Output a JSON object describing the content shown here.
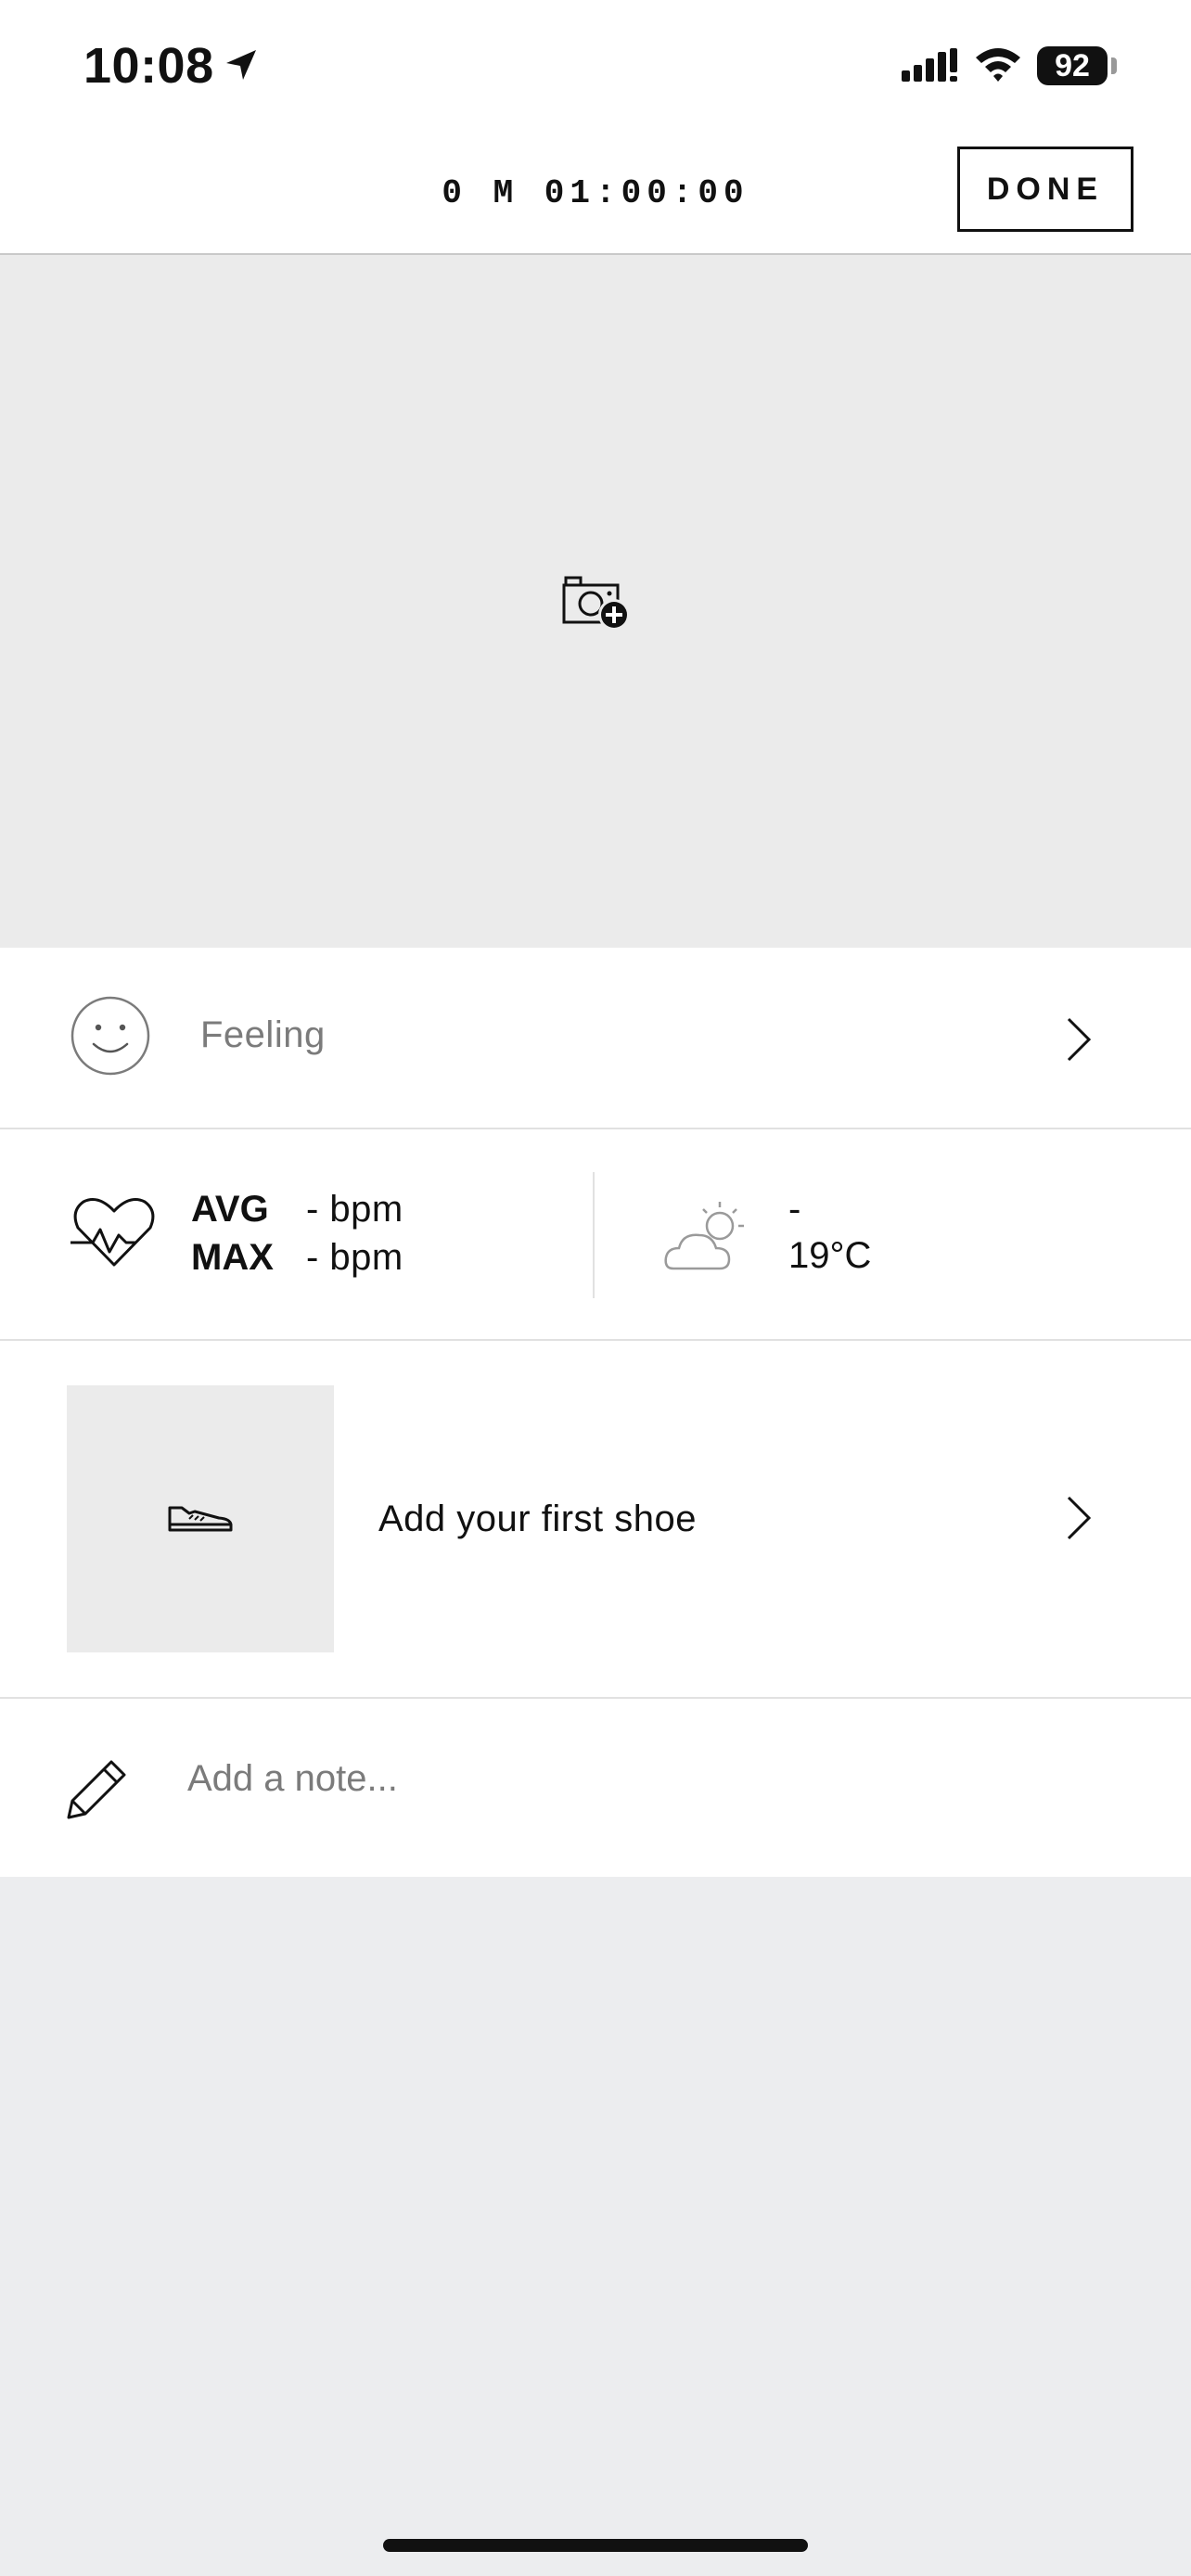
{
  "status_bar": {
    "time": "10:08",
    "battery": "92",
    "icons": [
      "location-arrow-icon",
      "cellular-signal-icon",
      "wifi-icon",
      "battery-icon"
    ]
  },
  "header": {
    "duration": "0 M 01:00:00",
    "done_label": "DONE"
  },
  "photo": {
    "icon": "camera-add-icon"
  },
  "feeling": {
    "label": "Feeling",
    "icon": "smiley-icon"
  },
  "heart_rate": {
    "avg_label": "AVG",
    "avg_value": "- bpm",
    "max_label": "MAX",
    "max_value": "- bpm",
    "icon": "heart-rate-icon"
  },
  "weather": {
    "condition": "-",
    "temperature": "19°C",
    "icon": "partly-cloudy-icon"
  },
  "shoe": {
    "label": "Add your first shoe",
    "icon": "shoe-icon"
  },
  "note": {
    "placeholder": "Add a note...",
    "value": "",
    "icon": "pencil-icon"
  }
}
